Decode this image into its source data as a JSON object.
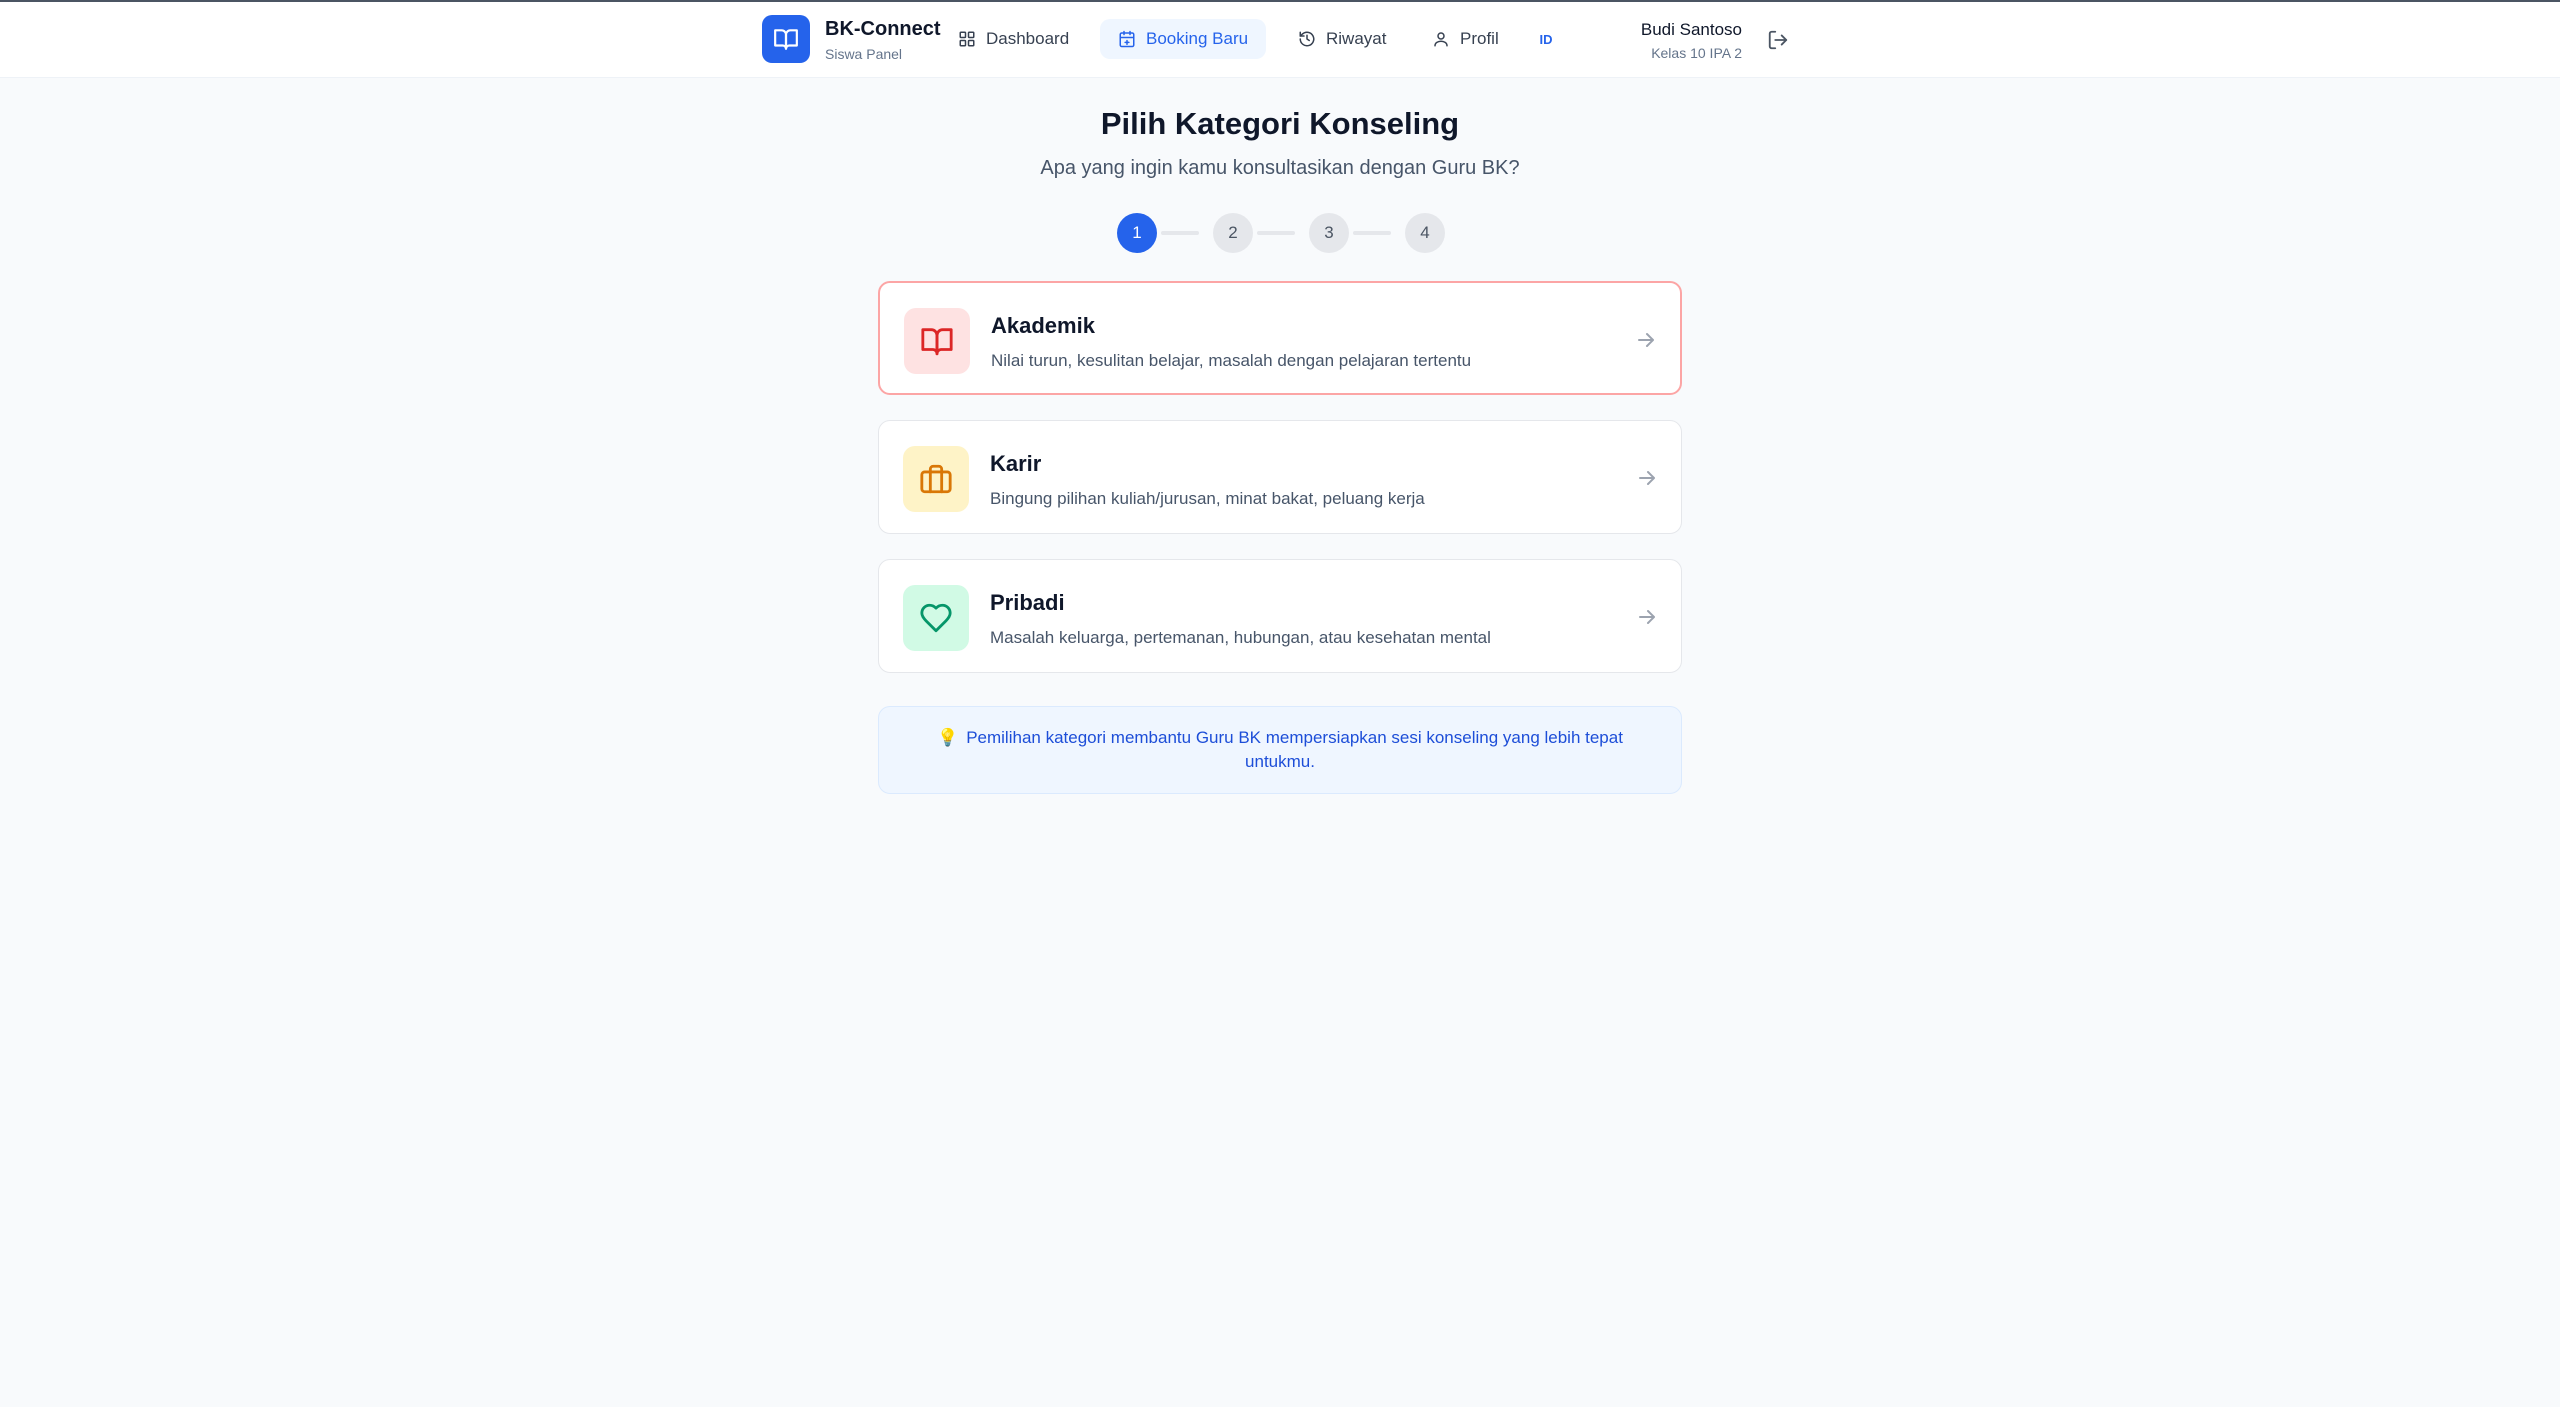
{
  "brand": {
    "name": "BK-Connect",
    "subtitle": "Siswa Panel"
  },
  "nav": {
    "items": [
      {
        "label": "Dashboard",
        "icon": "grid-icon",
        "active": false
      },
      {
        "label": "Booking Baru",
        "icon": "calendar-plus-icon",
        "active": true
      },
      {
        "label": "Riwayat",
        "icon": "history-icon",
        "active": false
      },
      {
        "label": "Profil",
        "icon": "user-icon",
        "active": false
      }
    ],
    "language": "ID"
  },
  "user": {
    "name": "Budi Santoso",
    "class": "Kelas 10 IPA 2"
  },
  "page": {
    "title": "Pilih Kategori Konseling",
    "subtitle": "Apa yang ingin kamu konsultasikan dengan Guru BK?"
  },
  "stepper": {
    "steps": [
      "1",
      "2",
      "3",
      "4"
    ],
    "current": 1
  },
  "categories": [
    {
      "title": "Akademik",
      "description": "Nilai turun, kesulitan belajar, masalah dengan pelajaran tertentu",
      "icon": "book-open-icon",
      "icon_color": "#dc2626",
      "icon_bg": "#fee2e2",
      "selected": true
    },
    {
      "title": "Karir",
      "description": "Bingung pilihan kuliah/jurusan, minat bakat, peluang kerja",
      "icon": "briefcase-icon",
      "icon_color": "#d97706",
      "icon_bg": "#fef3c7",
      "selected": false
    },
    {
      "title": "Pribadi",
      "description": "Masalah keluarga, pertemanan, hubungan, atau kesehatan mental",
      "icon": "heart-icon",
      "icon_color": "#059669",
      "icon_bg": "#d1fae5",
      "selected": false
    }
  ],
  "info": {
    "icon": "💡",
    "text": "Pemilihan kategori membantu Guru BK mempersiapkan sesi konseling yang lebih tepat untukmu."
  },
  "colors": {
    "primary": "#2563eb",
    "background": "#f8fafc",
    "selected_border": "#fca5a5"
  }
}
